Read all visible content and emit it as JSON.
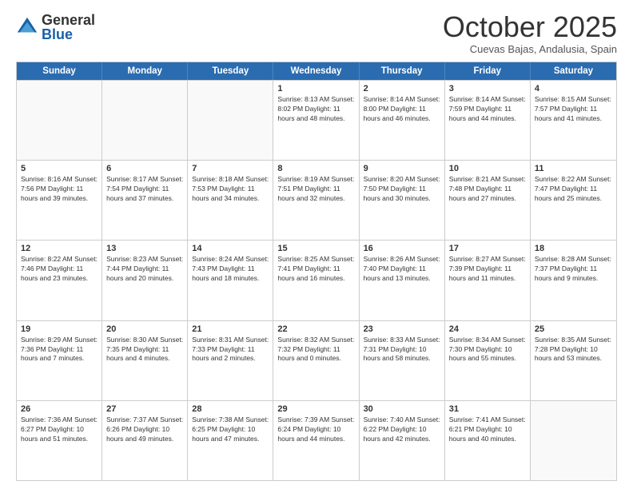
{
  "logo": {
    "general": "General",
    "blue": "Blue"
  },
  "header": {
    "month_title": "October 2025",
    "location": "Cuevas Bajas, Andalusia, Spain"
  },
  "weekdays": [
    "Sunday",
    "Monday",
    "Tuesday",
    "Wednesday",
    "Thursday",
    "Friday",
    "Saturday"
  ],
  "rows": [
    [
      {
        "day": "",
        "info": ""
      },
      {
        "day": "",
        "info": ""
      },
      {
        "day": "",
        "info": ""
      },
      {
        "day": "1",
        "info": "Sunrise: 8:13 AM\nSunset: 8:02 PM\nDaylight: 11 hours\nand 48 minutes."
      },
      {
        "day": "2",
        "info": "Sunrise: 8:14 AM\nSunset: 8:00 PM\nDaylight: 11 hours\nand 46 minutes."
      },
      {
        "day": "3",
        "info": "Sunrise: 8:14 AM\nSunset: 7:59 PM\nDaylight: 11 hours\nand 44 minutes."
      },
      {
        "day": "4",
        "info": "Sunrise: 8:15 AM\nSunset: 7:57 PM\nDaylight: 11 hours\nand 41 minutes."
      }
    ],
    [
      {
        "day": "5",
        "info": "Sunrise: 8:16 AM\nSunset: 7:56 PM\nDaylight: 11 hours\nand 39 minutes."
      },
      {
        "day": "6",
        "info": "Sunrise: 8:17 AM\nSunset: 7:54 PM\nDaylight: 11 hours\nand 37 minutes."
      },
      {
        "day": "7",
        "info": "Sunrise: 8:18 AM\nSunset: 7:53 PM\nDaylight: 11 hours\nand 34 minutes."
      },
      {
        "day": "8",
        "info": "Sunrise: 8:19 AM\nSunset: 7:51 PM\nDaylight: 11 hours\nand 32 minutes."
      },
      {
        "day": "9",
        "info": "Sunrise: 8:20 AM\nSunset: 7:50 PM\nDaylight: 11 hours\nand 30 minutes."
      },
      {
        "day": "10",
        "info": "Sunrise: 8:21 AM\nSunset: 7:48 PM\nDaylight: 11 hours\nand 27 minutes."
      },
      {
        "day": "11",
        "info": "Sunrise: 8:22 AM\nSunset: 7:47 PM\nDaylight: 11 hours\nand 25 minutes."
      }
    ],
    [
      {
        "day": "12",
        "info": "Sunrise: 8:22 AM\nSunset: 7:46 PM\nDaylight: 11 hours\nand 23 minutes."
      },
      {
        "day": "13",
        "info": "Sunrise: 8:23 AM\nSunset: 7:44 PM\nDaylight: 11 hours\nand 20 minutes."
      },
      {
        "day": "14",
        "info": "Sunrise: 8:24 AM\nSunset: 7:43 PM\nDaylight: 11 hours\nand 18 minutes."
      },
      {
        "day": "15",
        "info": "Sunrise: 8:25 AM\nSunset: 7:41 PM\nDaylight: 11 hours\nand 16 minutes."
      },
      {
        "day": "16",
        "info": "Sunrise: 8:26 AM\nSunset: 7:40 PM\nDaylight: 11 hours\nand 13 minutes."
      },
      {
        "day": "17",
        "info": "Sunrise: 8:27 AM\nSunset: 7:39 PM\nDaylight: 11 hours\nand 11 minutes."
      },
      {
        "day": "18",
        "info": "Sunrise: 8:28 AM\nSunset: 7:37 PM\nDaylight: 11 hours\nand 9 minutes."
      }
    ],
    [
      {
        "day": "19",
        "info": "Sunrise: 8:29 AM\nSunset: 7:36 PM\nDaylight: 11 hours\nand 7 minutes."
      },
      {
        "day": "20",
        "info": "Sunrise: 8:30 AM\nSunset: 7:35 PM\nDaylight: 11 hours\nand 4 minutes."
      },
      {
        "day": "21",
        "info": "Sunrise: 8:31 AM\nSunset: 7:33 PM\nDaylight: 11 hours\nand 2 minutes."
      },
      {
        "day": "22",
        "info": "Sunrise: 8:32 AM\nSunset: 7:32 PM\nDaylight: 11 hours\nand 0 minutes."
      },
      {
        "day": "23",
        "info": "Sunrise: 8:33 AM\nSunset: 7:31 PM\nDaylight: 10 hours\nand 58 minutes."
      },
      {
        "day": "24",
        "info": "Sunrise: 8:34 AM\nSunset: 7:30 PM\nDaylight: 10 hours\nand 55 minutes."
      },
      {
        "day": "25",
        "info": "Sunrise: 8:35 AM\nSunset: 7:28 PM\nDaylight: 10 hours\nand 53 minutes."
      }
    ],
    [
      {
        "day": "26",
        "info": "Sunrise: 7:36 AM\nSunset: 6:27 PM\nDaylight: 10 hours\nand 51 minutes."
      },
      {
        "day": "27",
        "info": "Sunrise: 7:37 AM\nSunset: 6:26 PM\nDaylight: 10 hours\nand 49 minutes."
      },
      {
        "day": "28",
        "info": "Sunrise: 7:38 AM\nSunset: 6:25 PM\nDaylight: 10 hours\nand 47 minutes."
      },
      {
        "day": "29",
        "info": "Sunrise: 7:39 AM\nSunset: 6:24 PM\nDaylight: 10 hours\nand 44 minutes."
      },
      {
        "day": "30",
        "info": "Sunrise: 7:40 AM\nSunset: 6:22 PM\nDaylight: 10 hours\nand 42 minutes."
      },
      {
        "day": "31",
        "info": "Sunrise: 7:41 AM\nSunset: 6:21 PM\nDaylight: 10 hours\nand 40 minutes."
      },
      {
        "day": "",
        "info": ""
      }
    ]
  ]
}
